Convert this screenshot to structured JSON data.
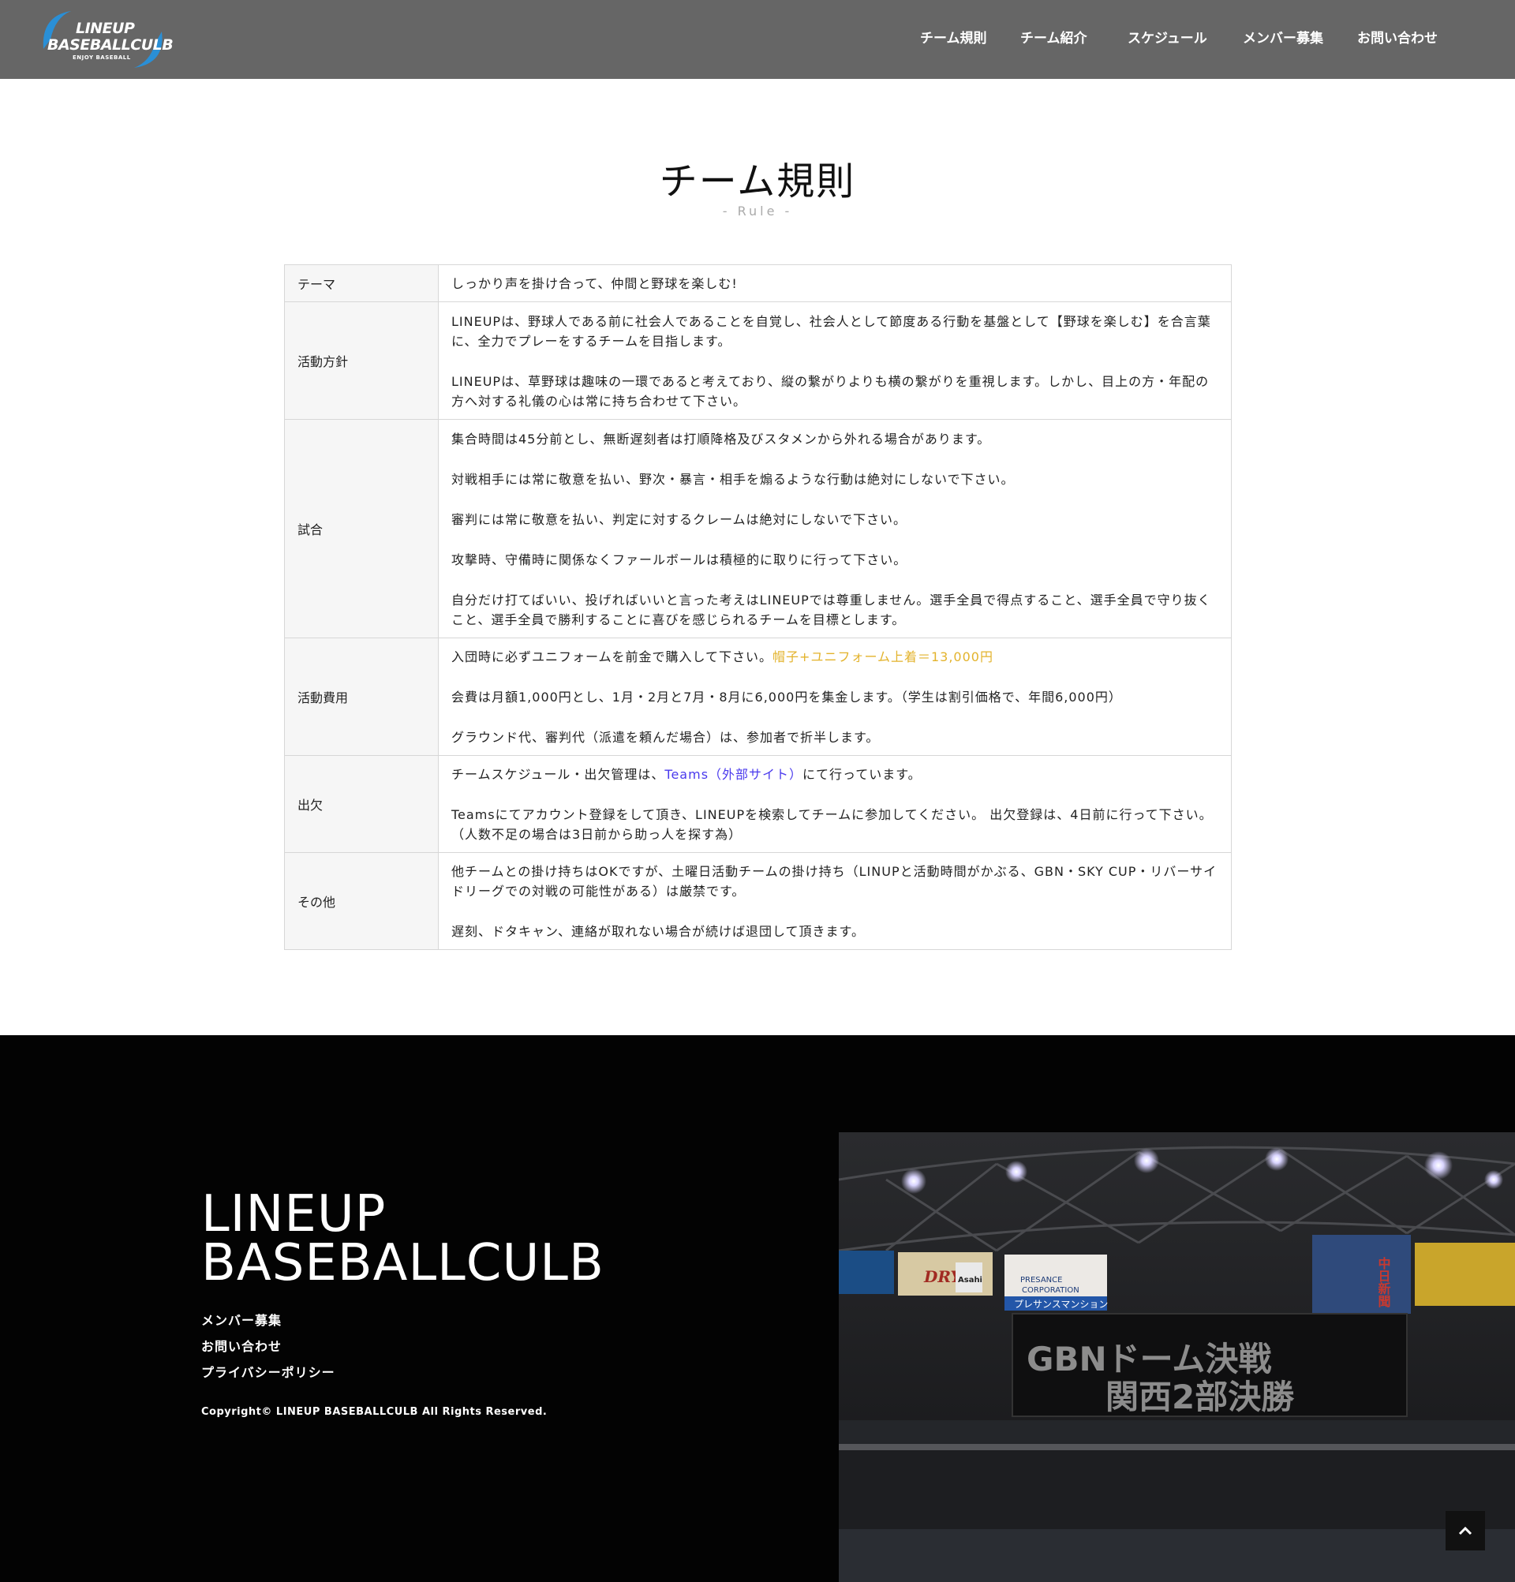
{
  "header": {
    "logo": {
      "line1": "LINEUP",
      "line2": "BASEBALLCULB",
      "line3": "ENJOY BASEBALL"
    },
    "nav": [
      "チーム規則",
      "チーム紹介",
      "スケジュール",
      "メンバー募集",
      "お問い合わせ"
    ]
  },
  "main": {
    "title": "チーム規則",
    "subtitle": "- Rule -",
    "rows": [
      {
        "label": "テーマ",
        "paras": [
          "しっかり声を掛け合って、仲間と野球を楽しむ!"
        ]
      },
      {
        "label": "活動方針",
        "paras": [
          "LINEUPは、野球人である前に社会人であることを自覚し、社会人として節度ある行動を基盤として【野球を楽しむ】を合言葉に、全力でプレーをするチームを目指します。",
          "LINEUPは、草野球は趣味の一環であると考えており、縦の繋がりよりも横の繋がりを重視します。しかし、目上の方・年配の方へ対する礼儀の心は常に持ち合わせて下さい。"
        ]
      },
      {
        "label": "試合",
        "paras": [
          "集合時間は45分前とし、無断遅刻者は打順降格及びスタメンから外れる場合があります。",
          "対戦相手には常に敬意を払い、野次・暴言・相手を煽るような行動は絶対にしないで下さい。",
          "審判には常に敬意を払い、判定に対するクレームは絶対にしないで下さい。",
          "攻撃時、守備時に関係なくファールボールは積極的に取りに行って下さい。",
          "自分だけ打てばいい、投げればいいと言った考えはLINEUPでは尊重しません。選手全員で得点すること、選手全員で守り抜くこと、選手全員で勝利することに喜びを感じられるチームを目標とします。"
        ]
      },
      {
        "label": "活動費用",
        "fee_text": "入団時に必ずユニフォームを前金で購入して下さい。",
        "fee_highlight": "帽子+ユニフォーム上着＝13,000円",
        "paras": [
          "会費は月額1,000円とし、1月・2月と7月・8月に6,000円を集金します。（学生は割引価格で、年間6,000円）",
          "グラウンド代、審判代（派遣を頼んだ場合）は、参加者で折半します。"
        ]
      },
      {
        "label": "出欠",
        "att_pre": "チームスケジュール・出欠管理は、",
        "att_link": "Teams（外部サイト）",
        "att_post": "にて行っています。",
        "paras": [
          "Teamsにてアカウント登録をして頂き、LINEUPを検索してチームに参加してください。 出欠登録は、4日前に行って下さい。（人数不足の場合は3日前から助っ人を探す為）"
        ]
      },
      {
        "label": "その他",
        "paras": [
          "他チームとの掛け持ちはOKですが、土曜日活動チームの掛け持ち（LINUPと活動時間がかぶる、GBN・SKY CUP・リバーサイドリーグでの対戦の可能性がある）は厳禁です。",
          "遅刻、ドタキャン、連絡が取れない場合が続けば退団して頂きます。"
        ]
      }
    ]
  },
  "footer": {
    "title_line1": "LINEUP",
    "title_line2": "BASEBALLCULB",
    "links": [
      "メンバー募集",
      "お問い合わせ",
      "プライバシーポリシー"
    ],
    "copyright": "Copyright© LINEUP BASEBALLCULB All Rights Reserved.",
    "photo": {
      "caption_line1": "GBNドーム決戦",
      "caption_line2": "関西2部決勝",
      "sign_beer": "DRY",
      "sign_news": "中日新聞",
      "sign_brand": "Asahi",
      "sign_corp1": "PRESANCE",
      "sign_corp2": "CORPORATION",
      "sign_mansion": "プレサンスマンション"
    }
  },
  "colors": {
    "header_bg": "#666666",
    "footer_bg": "#030303",
    "highlight": "#e3b32c",
    "link": "#4a3aed",
    "logo_accent": "#2a8fd6"
  },
  "icons": {
    "back_to_top": "chevron-up-icon"
  }
}
